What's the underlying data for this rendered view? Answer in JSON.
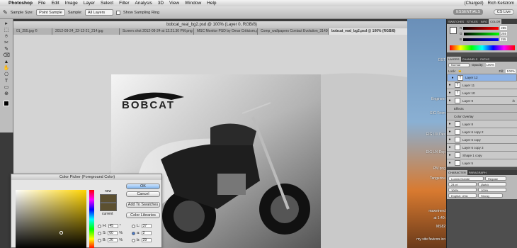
{
  "menubar": {
    "apple": "",
    "app": "Photoshop",
    "items": [
      "File",
      "Edit",
      "Image",
      "Layer",
      "Select",
      "Filter",
      "Analysis",
      "3D",
      "View",
      "Window",
      "Help"
    ],
    "battery": "(Charged)",
    "user": "Rich Kelstrom"
  },
  "options": {
    "sample_size_label": "Sample Size:",
    "sample_size": "Point Sample",
    "sample_label": "Sample:",
    "sample": "All Layers",
    "show_ring": "Show Sampling Ring",
    "workspace": "ESSENTIALS",
    "cs_live": "CS Live"
  },
  "document": {
    "title": "bobcat_real_bg2.psd @ 100% (Layer 0, RGB/8)",
    "tabs": [
      "01_255.jpg ©",
      "2012-09-24_22-12-21_214.jpg",
      "Screen shot 2012-09-24 at 12.21.30 PM.png",
      "MSC Monitor PSD by Omar Criticism.psd",
      "Comp_wallpapers Contact Evolution_314305_...",
      "bobcat_real_bg2.psd @ 100% (RGB/8)"
    ],
    "active_tab": 5,
    "logo_text": "BOBCAT"
  },
  "tools": [
    "▸",
    "⬚",
    "⌾",
    "✂",
    "✎",
    "⌫",
    "▲",
    "✋",
    "⎔",
    "T",
    "▭",
    "⊕"
  ],
  "color_picker": {
    "title": "Color Picker (Foreground Color)",
    "ok": "OK",
    "cancel": "Cancel",
    "add_swatches": "Add To Swatches",
    "color_libraries": "Color Libraries",
    "new_label": "new",
    "current_label": "current",
    "fields": [
      {
        "label": "H:",
        "value": "45",
        "unit": "°",
        "selected": false
      },
      {
        "label": "S:",
        "value": "60",
        "unit": "%",
        "selected": false
      },
      {
        "label": "B:",
        "value": "26",
        "unit": "%",
        "selected": false
      },
      {
        "label": "L:",
        "value": "37",
        "unit": "",
        "selected": false
      },
      {
        "label": "a:",
        "value": "2",
        "unit": "",
        "selected": true
      },
      {
        "label": "b:",
        "value": "29",
        "unit": "",
        "selected": false
      }
    ],
    "new_color": "#5c5030"
  },
  "desktop_files": [
    "DST",
    "Engineer",
    "EIG From",
    "EIG UX Des",
    "EIG UX Dep",
    "PM.png",
    "Tangerine",
    "maxetrend",
    "at 1:40:",
    "MS82",
    "my site favicon.ico"
  ],
  "panels": {
    "top_tabs": [
      "SWATCHES",
      "STYLES",
      "INFO",
      "COLOR"
    ],
    "rgb": [
      {
        "label": "R",
        "value": "255"
      },
      {
        "label": "G",
        "value": "255"
      },
      {
        "label": "B",
        "value": "255"
      }
    ],
    "layers_tabs": [
      "LAYERS",
      "CHANNELS",
      "PATHS"
    ],
    "blend": "Normal",
    "opacity_label": "Opacity:",
    "opacity": "100%",
    "fill_label": "Fill:",
    "fill": "100%",
    "lock_label": "Lock:",
    "layers": [
      {
        "name": "Layer 12",
        "thumb": "T",
        "selected": true
      },
      {
        "name": "Layer 11",
        "thumb": "T",
        "selected": false
      },
      {
        "name": "Layer 10",
        "thumb": "T",
        "selected": false
      },
      {
        "name": "Layer 9",
        "thumb": "",
        "selected": false
      },
      {
        "name": "Effects",
        "thumb": "",
        "selected": false,
        "sub": true
      },
      {
        "name": "Color Overlay",
        "thumb": "",
        "selected": false,
        "sub": true
      },
      {
        "name": "Layer 8",
        "thumb": "",
        "selected": false
      },
      {
        "name": "Layer 6 copy 2",
        "thumb": "",
        "selected": false
      },
      {
        "name": "Layer 6 copy",
        "thumb": "",
        "selected": false
      },
      {
        "name": "Layer 6 copy 3",
        "thumb": "",
        "selected": false
      },
      {
        "name": "Shape 1 copy",
        "thumb": "",
        "selected": false
      },
      {
        "name": "Layer 5",
        "thumb": "",
        "selected": false
      }
    ],
    "char_tabs": [
      "CHARACTER",
      "PARAGRAPH"
    ],
    "font": "Lucida Grande",
    "style": "Regular",
    "size": "24 pt",
    "leading": "(Auto)",
    "scale_v": "100%",
    "scale_h": "100%",
    "language": "English: USA",
    "aa": "Strong"
  }
}
